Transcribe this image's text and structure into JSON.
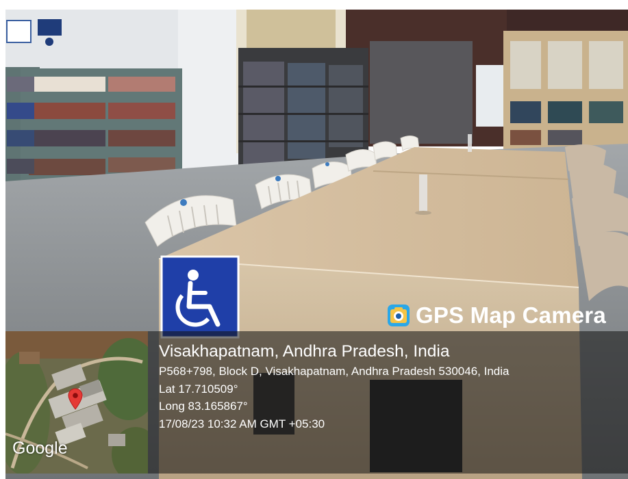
{
  "brand": {
    "title": "GPS Map Camera",
    "icon": "gps-map-camera-app-icon",
    "accent": "#2aa7e8"
  },
  "map": {
    "provider_label": "Google",
    "pin_icon": "map-pin-icon",
    "pin_color": "#e53935"
  },
  "location": {
    "title": "Visakhapatnam, Andhra Pradesh, India",
    "address": "P568+798, Block D, Visakhapatnam, Andhra Pradesh 530046, India",
    "lat": "Lat 17.710509°",
    "long": "Long 83.165867°",
    "timestamp": "17/08/23 10:32 AM GMT +05:30"
  },
  "scene": {
    "accessibility_sign_icon": "wheelchair-icon",
    "accessibility_sign_color": "#1f3fa8",
    "floor_color": "#8c8f92",
    "table_color": "#dcc7aa",
    "shelf_color": "#5e7372"
  }
}
